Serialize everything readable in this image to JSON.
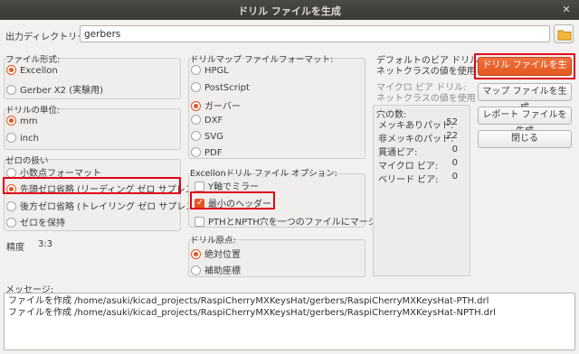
{
  "window": {
    "title": "ドリル ファイルを生成",
    "close_glyph": "✕"
  },
  "output_dir": {
    "label": "出力ディレクトリー:",
    "value": "gerbers"
  },
  "file_format": {
    "label": "ファイル形式:",
    "options": [
      "Excellon",
      "Gerber X2 (実験用)"
    ],
    "selected": 0
  },
  "units": {
    "label": "ドリルの単位:",
    "options": [
      "mm",
      "inch"
    ],
    "selected": 0
  },
  "zeros": {
    "label": "ゼロの扱い",
    "options": [
      "小数点フォーマット",
      "先頭ゼロ省略 (リーディング ゼロ サプレス)",
      "後方ゼロ省略 (トレイリング ゼロ サプレス)",
      "ゼロを保持"
    ],
    "selected": 1
  },
  "precision": {
    "label": "精度",
    "value": "3:3"
  },
  "map_format": {
    "label": "ドリルマップ ファイルフォーマット:",
    "options": [
      "HPGL",
      "PostScript",
      "ガーバー",
      "DXF",
      "SVG",
      "PDF"
    ],
    "selected": 2
  },
  "excellon_options": {
    "label": "Excellonドリル ファイル オプション:",
    "items": [
      {
        "label": "Y軸でミラー",
        "checked": false
      },
      {
        "label": "最小のヘッダー",
        "checked": true
      },
      {
        "label": "PTHとNPTH穴を一つのファイルにマージ",
        "checked": false
      }
    ]
  },
  "drill_origin": {
    "label": "ドリル原点:",
    "options": [
      "絶対位置",
      "補助座標"
    ],
    "selected": 0
  },
  "via_info": {
    "default_label": "デフォルトのビア ドリル:",
    "default_value": "ネットクラスの値を使用",
    "micro_label": "マイクロ ビア ドリル:",
    "micro_value": "ネットクラスの値を使用"
  },
  "hole_counts": {
    "label": "穴の数:",
    "rows": [
      {
        "label": "メッキありパッド:",
        "value": "52"
      },
      {
        "label": "非メッキのパッド:",
        "value": "22"
      },
      {
        "label": "貫通ビア:",
        "value": "0"
      },
      {
        "label": "マイクロ ビア:",
        "value": "0"
      },
      {
        "label": "ベリード ビア:",
        "value": "0"
      }
    ]
  },
  "buttons": {
    "generate_drill": "ドリル ファイルを生成",
    "generate_map": "マップ ファイルを生成",
    "generate_report": "レポート ファイルを生成",
    "close": "閉じる"
  },
  "messages": {
    "label": "メッセージ:",
    "lines": [
      "ファイルを作成 /home/asuki/kicad_projects/RaspiCherryMXKeysHat/gerbers/RaspiCherryMXKeysHat-PTH.drl",
      "ファイルを作成 /home/asuki/kicad_projects/RaspiCherryMXKeysHat/gerbers/RaspiCherryMXKeysHat-NPTH.drl"
    ]
  },
  "colors": {
    "accent": "#e95420",
    "highlight": "#e0001a"
  }
}
